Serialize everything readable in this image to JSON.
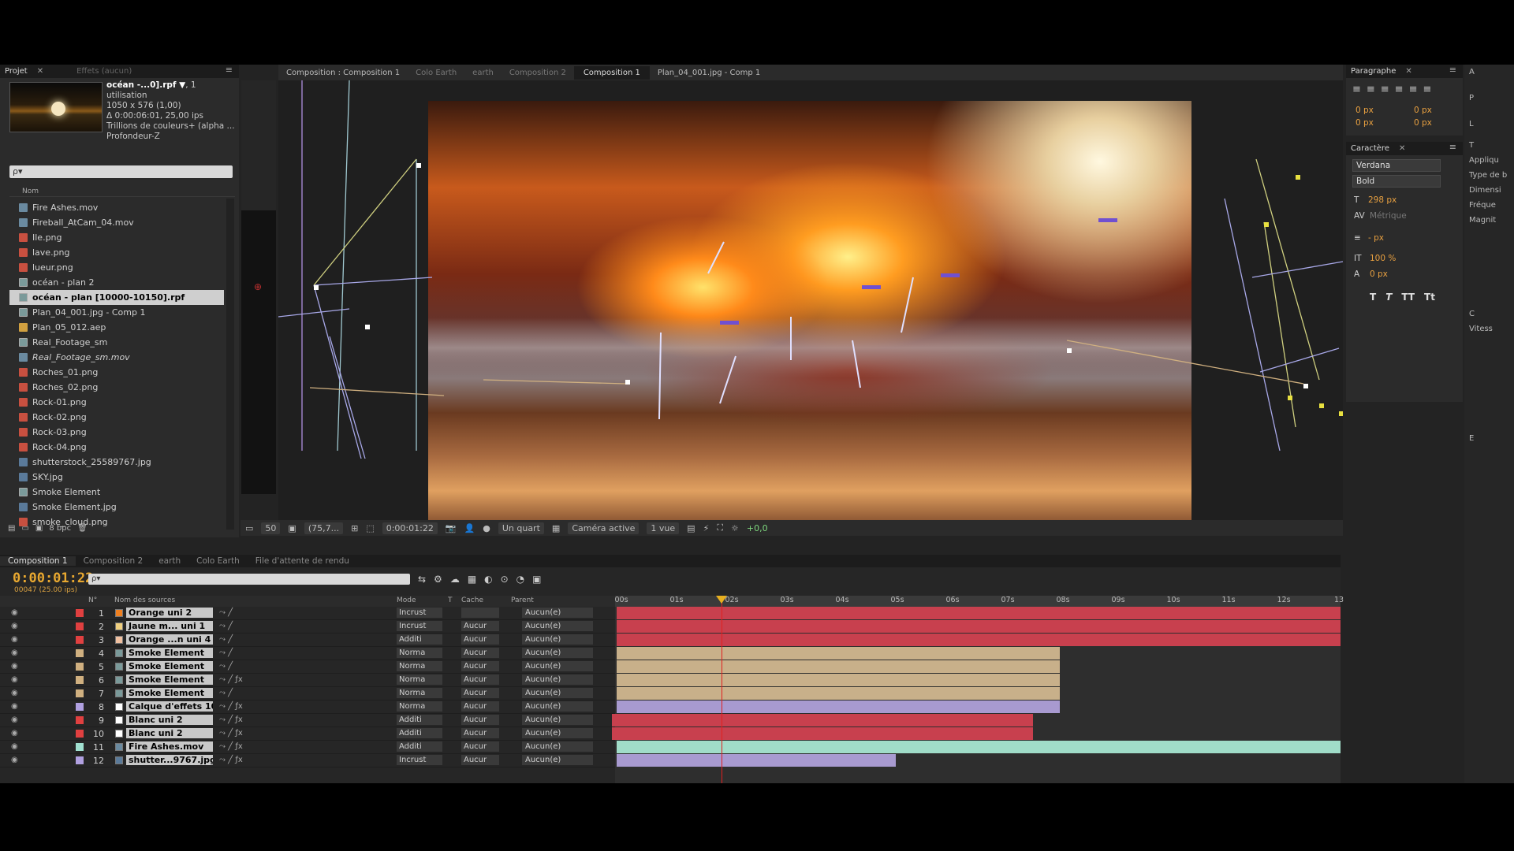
{
  "project_panel": {
    "tabs": [
      "Projet",
      "Effets (aucun)"
    ],
    "selected_file": "océan -...0].rpf ▼",
    "usage": ", 1 utilisation",
    "dimensions": "1050 x 576 (1,00)",
    "duration": "Δ 0:00:06:01, 25,00 ips",
    "colors": "Trillions de couleurs+ (alpha ...",
    "depth": "Profondeur-Z",
    "search_placeholder": "ρ▾",
    "column_name": "Nom",
    "items": [
      {
        "name": "Fire Ashes.mov",
        "type": "mov"
      },
      {
        "name": "Fireball_AtCam_04.mov",
        "type": "mov"
      },
      {
        "name": "Ile.png",
        "type": "png"
      },
      {
        "name": "lave.png",
        "type": "png"
      },
      {
        "name": "lueur.png",
        "type": "png"
      },
      {
        "name": "océan - plan 2",
        "type": "comp"
      },
      {
        "name": "océan - plan [10000-10150].rpf",
        "type": "comp",
        "selected": true
      },
      {
        "name": "Plan_04_001.jpg - Comp 1",
        "type": "comp"
      },
      {
        "name": "Plan_05_012.aep",
        "type": "aep"
      },
      {
        "name": "Real_Footage_sm",
        "type": "comp"
      },
      {
        "name": "Real_Footage_sm.mov",
        "type": "mov",
        "italic": true
      },
      {
        "name": "Roches_01.png",
        "type": "png"
      },
      {
        "name": "Roches_02.png",
        "type": "png"
      },
      {
        "name": "Rock-01.png",
        "type": "png"
      },
      {
        "name": "Rock-02.png",
        "type": "png"
      },
      {
        "name": "Rock-03.png",
        "type": "png"
      },
      {
        "name": "Rock-04.png",
        "type": "png"
      },
      {
        "name": "shutterstock_25589767.jpg",
        "type": "jpg"
      },
      {
        "name": "SKY.jpg",
        "type": "jpg"
      },
      {
        "name": "Smoke Element",
        "type": "comp"
      },
      {
        "name": "Smoke Element.jpg",
        "type": "jpg"
      },
      {
        "name": "smoke_cloud.png",
        "type": "png"
      }
    ],
    "bpc": "8 bpc"
  },
  "viewer": {
    "panel_title": "Composition : Composition 1",
    "breadcrumbs": [
      "Colo Earth",
      "earth",
      "Composition 2",
      "Composition 1",
      "Plan_04_001.jpg - Comp 1"
    ],
    "active_crumb": "Composition 1",
    "zoom": "(75,7...",
    "timecode": "0:00:01:22",
    "resolution": "Un quart",
    "camera": "Caméra active",
    "views": "1 vue",
    "exposure": "+0,0",
    "frame_rate_box": "50"
  },
  "paragraph_panel": {
    "title": "Paragraphe",
    "indent_values": [
      "0 px",
      "0 px",
      "0 px",
      "0 px"
    ]
  },
  "character_panel": {
    "title": "Caractère",
    "font": "Verdana",
    "style": "Bold",
    "size": "298 px",
    "tracking": "Métrique",
    "leading": "- px",
    "scale": "100 %",
    "baseline": "0 px",
    "buttons": [
      "T",
      "T",
      "TT",
      "Tt"
    ]
  },
  "far_right": {
    "items": [
      "A",
      "P",
      "L",
      "T",
      "Appliqu",
      "Type de b",
      "Dimensi",
      "Fréque",
      "Magnit",
      "C",
      "Vitess",
      "E"
    ]
  },
  "timeline": {
    "tabs": [
      "Composition 1",
      "Composition 2",
      "earth",
      "Colo Earth",
      "File d'attente de rendu"
    ],
    "timecode": "0:00:01:22",
    "frames": "00047 (25.00 ips)",
    "search_placeholder": "ρ▾",
    "col_num": "N°",
    "col_name": "Nom des sources",
    "col_mode": "Mode",
    "col_t": "T",
    "col_cache": "Cache",
    "col_parent": "Parent",
    "ruler": [
      "00s",
      "01s",
      "02s",
      "03s",
      "04s",
      "05s",
      "06s",
      "07s",
      "08s",
      "09s",
      "10s",
      "11s",
      "12s",
      "13"
    ],
    "layers": [
      {
        "num": "1",
        "name": "Orange uni 2",
        "mode": "Incrust",
        "cache": "",
        "parent": "Aucun(e)",
        "color": "#e04040",
        "sw": "#f08020",
        "fx": false
      },
      {
        "num": "2",
        "name": "Jaune m... uni 1",
        "mode": "Incrust",
        "cache": "Aucur",
        "parent": "Aucun(e)",
        "color": "#e04040",
        "sw": "#f0d080",
        "fx": false
      },
      {
        "num": "3",
        "name": "Orange ...n uni 4",
        "mode": "Additi",
        "cache": "Aucur",
        "parent": "Aucun(e)",
        "color": "#e04040",
        "sw": "#f0c0a0",
        "fx": false
      },
      {
        "num": "4",
        "name": "Smoke Element",
        "mode": "Norma",
        "cache": "Aucur",
        "parent": "Aucun(e)",
        "color": "#d0b080",
        "sw": "#7a9a9a",
        "fx": false
      },
      {
        "num": "5",
        "name": "Smoke Element",
        "mode": "Norma",
        "cache": "Aucur",
        "parent": "Aucun(e)",
        "color": "#d0b080",
        "sw": "#7a9a9a",
        "fx": false
      },
      {
        "num": "6",
        "name": "Smoke Element",
        "mode": "Norma",
        "cache": "Aucur",
        "parent": "Aucun(e)",
        "color": "#d0b080",
        "sw": "#7a9a9a",
        "fx": true
      },
      {
        "num": "7",
        "name": "Smoke Element",
        "mode": "Norma",
        "cache": "Aucur",
        "parent": "Aucun(e)",
        "color": "#d0b080",
        "sw": "#7a9a9a",
        "fx": false
      },
      {
        "num": "8",
        "name": "Calque d'effets 10",
        "mode": "Norma",
        "cache": "Aucur",
        "parent": "Aucun(e)",
        "color": "#b0a0e0",
        "sw": "#ffffff",
        "fx": true
      },
      {
        "num": "9",
        "name": "Blanc uni 2",
        "mode": "Additi",
        "cache": "Aucur",
        "parent": "Aucun(e)",
        "color": "#e04040",
        "sw": "#ffffff",
        "fx": true
      },
      {
        "num": "10",
        "name": "Blanc uni 2",
        "mode": "Additi",
        "cache": "Aucur",
        "parent": "Aucun(e)",
        "color": "#e04040",
        "sw": "#ffffff",
        "fx": true
      },
      {
        "num": "11",
        "name": "Fire Ashes.mov",
        "mode": "Additi",
        "cache": "Aucur",
        "parent": "Aucun(e)",
        "color": "#a0e0d0",
        "sw": "#6a8aa0",
        "fx": true
      },
      {
        "num": "12",
        "name": "shutter...9767.jpg",
        "mode": "Incrust",
        "cache": "Aucur",
        "parent": "Aucun(e)",
        "color": "#b0a0e0",
        "sw": "#5a7a9a",
        "fx": true
      }
    ]
  },
  "colors": {
    "bar_red": "#c8404e",
    "bar_tan": "#c8b08a",
    "bar_lavender": "#a89ad0",
    "bar_teal": "#a0dcc8",
    "timecode_orange": "#e8a830"
  }
}
